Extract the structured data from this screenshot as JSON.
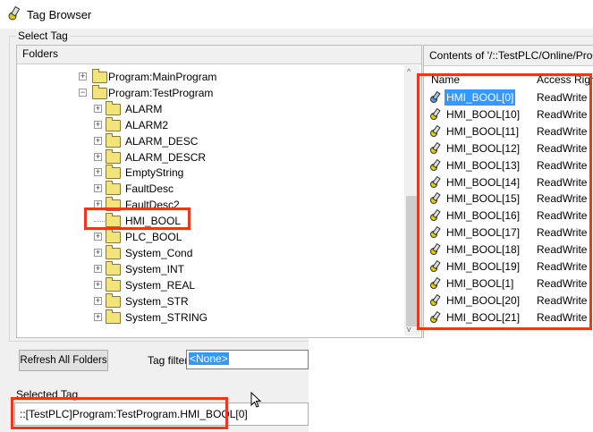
{
  "window": {
    "title": "Tag Browser",
    "icon": "tag-browser-icon"
  },
  "group_label": "Select Tag",
  "folders": {
    "header": "Folders",
    "items": [
      {
        "label": "Program:MainProgram",
        "level": 1,
        "expander": "+"
      },
      {
        "label": "Program:TestProgram",
        "level": 1,
        "expander": "-"
      },
      {
        "label": "ALARM",
        "level": 2,
        "expander": "+"
      },
      {
        "label": "ALARM2",
        "level": 2,
        "expander": "+"
      },
      {
        "label": "ALARM_DESC",
        "level": 2,
        "expander": "+"
      },
      {
        "label": "ALARM_DESCR",
        "level": 2,
        "expander": "+"
      },
      {
        "label": "EmptyString",
        "level": 2,
        "expander": "+"
      },
      {
        "label": "FaultDesc",
        "level": 2,
        "expander": "+"
      },
      {
        "label": "FaultDesc2",
        "level": 2,
        "expander": "+"
      },
      {
        "label": "HMI_BOOL",
        "level": 2,
        "expander": "",
        "selected": true
      },
      {
        "label": "PLC_BOOL",
        "level": 2,
        "expander": "+"
      },
      {
        "label": "System_Cond",
        "level": 2,
        "expander": "+"
      },
      {
        "label": "System_INT",
        "level": 2,
        "expander": "+"
      },
      {
        "label": "System_REAL",
        "level": 2,
        "expander": "+"
      },
      {
        "label": "System_STR",
        "level": 2,
        "expander": "+"
      },
      {
        "label": "System_STRING",
        "level": 2,
        "expander": "+"
      }
    ]
  },
  "contents": {
    "header": "Contents of '/::TestPLC/Online/Progra",
    "columns": [
      "Name",
      "Access Righ"
    ],
    "rows": [
      {
        "name": "HMI_BOOL[0]",
        "access": "ReadWrite",
        "selected": true
      },
      {
        "name": "HMI_BOOL[10]",
        "access": "ReadWrite"
      },
      {
        "name": "HMI_BOOL[11]",
        "access": "ReadWrite"
      },
      {
        "name": "HMI_BOOL[12]",
        "access": "ReadWrite"
      },
      {
        "name": "HMI_BOOL[13]",
        "access": "ReadWrite"
      },
      {
        "name": "HMI_BOOL[14]",
        "access": "ReadWrite"
      },
      {
        "name": "HMI_BOOL[15]",
        "access": "ReadWrite"
      },
      {
        "name": "HMI_BOOL[16]",
        "access": "ReadWrite"
      },
      {
        "name": "HMI_BOOL[17]",
        "access": "ReadWrite"
      },
      {
        "name": "HMI_BOOL[18]",
        "access": "ReadWrite"
      },
      {
        "name": "HMI_BOOL[19]",
        "access": "ReadWrite"
      },
      {
        "name": "HMI_BOOL[1]",
        "access": "ReadWrite"
      },
      {
        "name": "HMI_BOOL[20]",
        "access": "ReadWrite"
      },
      {
        "name": "HMI_BOOL[21]",
        "access": "ReadWrite"
      }
    ]
  },
  "refresh_label": "Refresh All Folders",
  "tag_filter": {
    "label": "Tag filter:",
    "value": "<None>"
  },
  "selected_tag": {
    "label": "Selected Tag",
    "value": "::[TestPLC]Program:TestProgram.HMI_BOOL[0]"
  },
  "colors": {
    "highlight_box": "#e8391b",
    "selection": "#3399ff",
    "folder": "#f2e37a"
  }
}
